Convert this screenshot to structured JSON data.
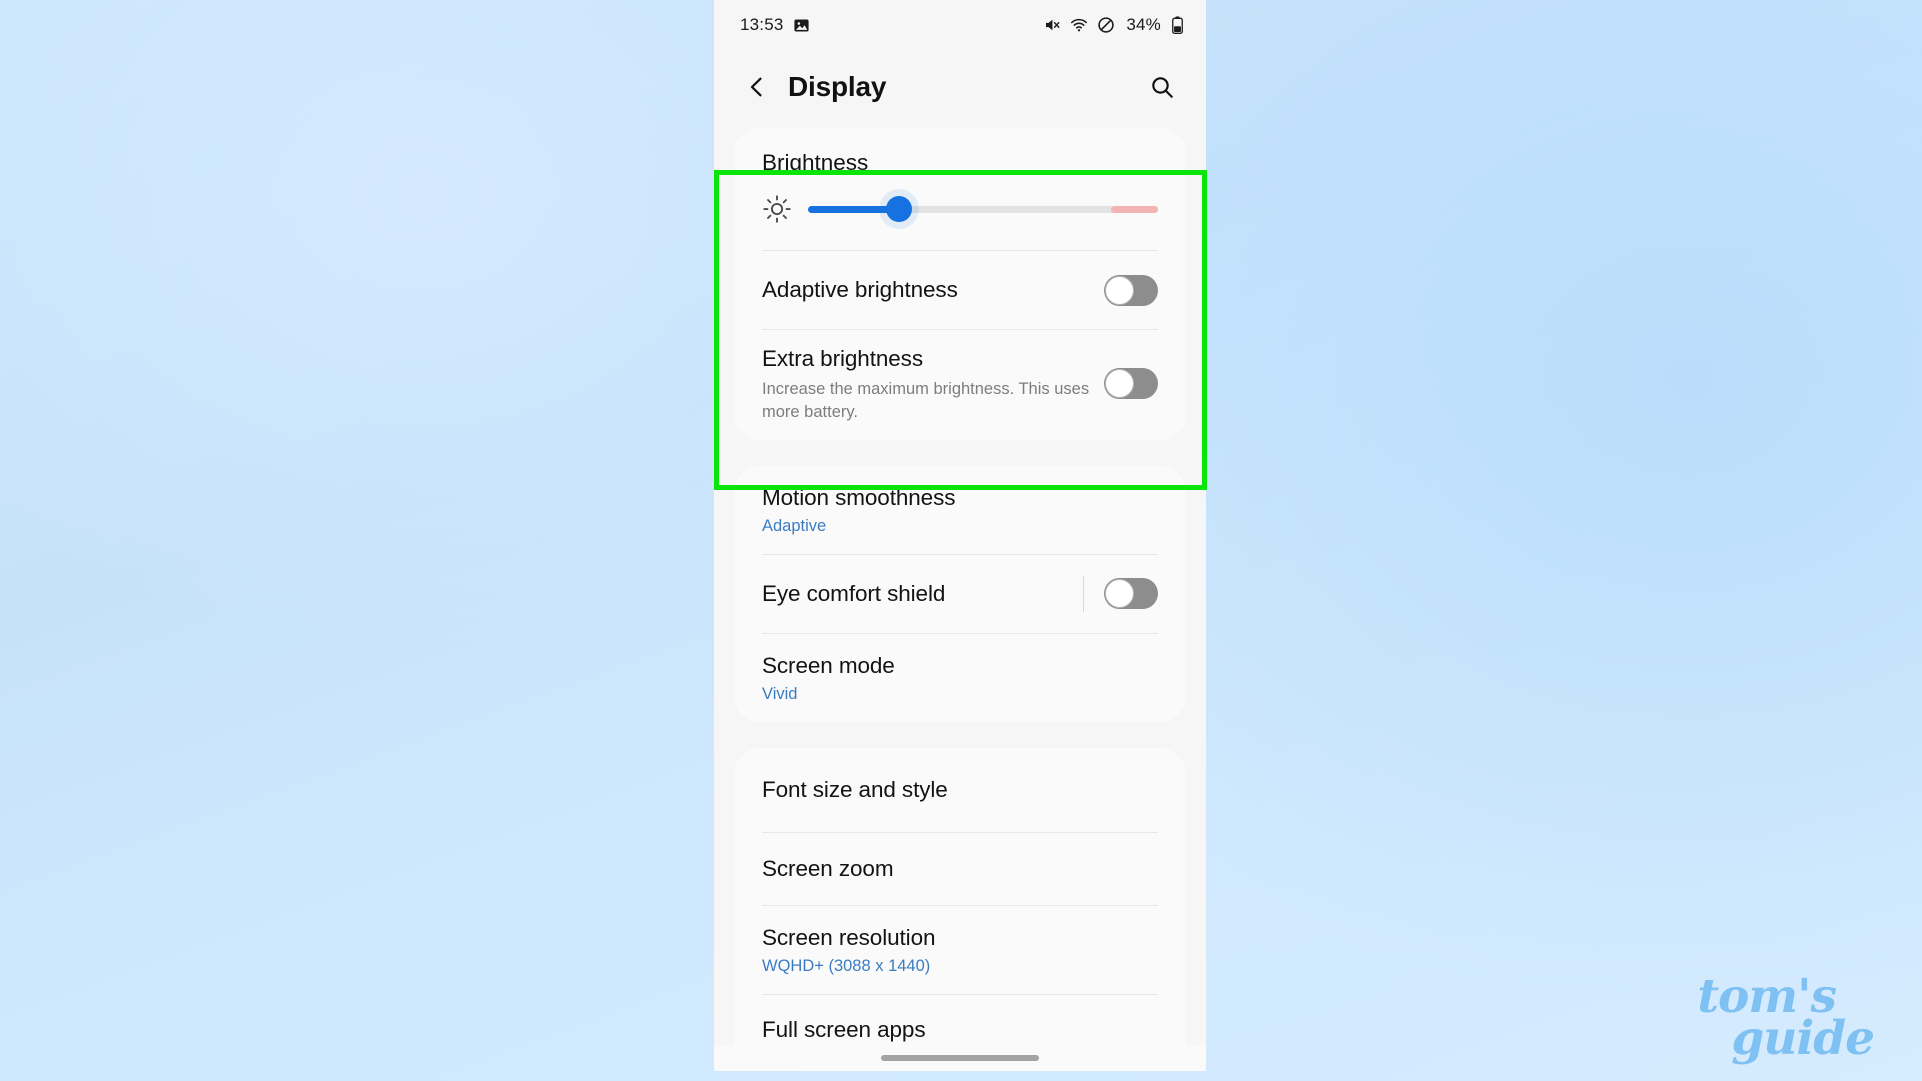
{
  "statusbar": {
    "time": "13:53",
    "photo_icon": "image-icon",
    "mute_icon": "mute-icon",
    "wifi_icon": "wifi-icon",
    "dnd_icon": "do-not-disturb-icon",
    "battery_percent": "34%",
    "battery_icon": "battery-icon"
  },
  "appbar": {
    "back_icon": "chevron-left-icon",
    "title": "Display",
    "search_icon": "search-icon"
  },
  "brightness": {
    "section_title": "Brightness",
    "sun_icon": "brightness-sun-icon",
    "slider_value": 26,
    "slider_min": 0,
    "slider_max": 100,
    "extra_zone_label": "extra-brightness-zone",
    "adaptive": {
      "label": "Adaptive brightness",
      "toggle_state": "off"
    },
    "extra": {
      "label": "Extra brightness",
      "description": "Increase the maximum brightness. This uses more battery.",
      "toggle_state": "off"
    }
  },
  "display_card": {
    "motion_smoothness": {
      "label": "Motion smoothness",
      "value": "Adaptive"
    },
    "eye_comfort_shield": {
      "label": "Eye comfort shield",
      "toggle_state": "off"
    },
    "screen_mode": {
      "label": "Screen mode",
      "value": "Vivid"
    }
  },
  "layout_card": {
    "font_size_and_style": {
      "label": "Font size and style"
    },
    "screen_zoom": {
      "label": "Screen zoom"
    },
    "screen_resolution": {
      "label": "Screen resolution",
      "value": "WQHD+ (3088 x 1440)"
    },
    "full_screen_apps": {
      "label": "Full screen apps"
    }
  },
  "gesture_bar": "home-gesture-bar",
  "highlight": {
    "name": "brightness-section-highlight",
    "color": "#09e509"
  },
  "watermark": {
    "line1": "tom's",
    "line2": "guide",
    "color": "#7cc0f2"
  }
}
